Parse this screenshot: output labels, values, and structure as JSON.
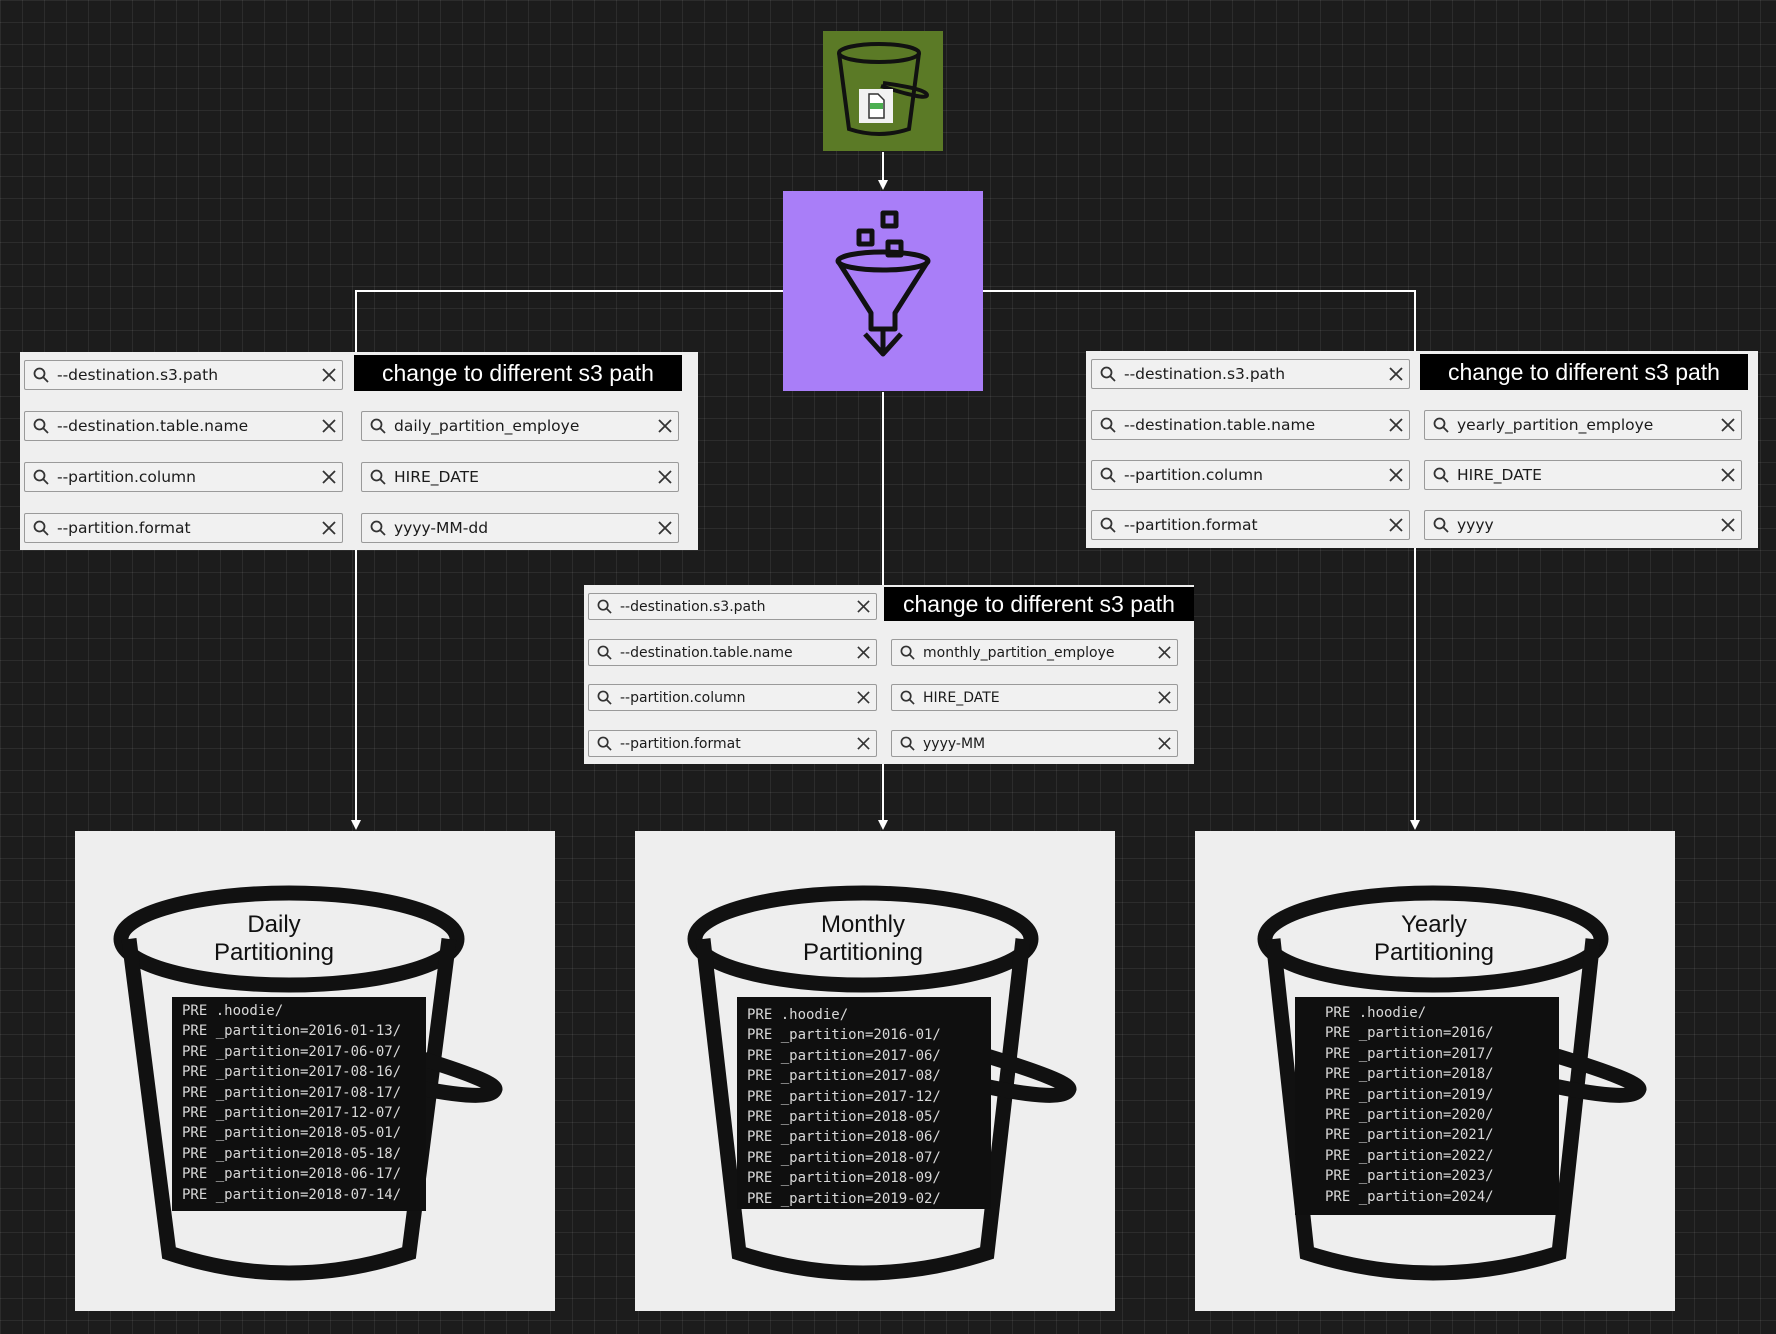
{
  "panels": {
    "daily": {
      "note": "change to different s3 path",
      "param_keys": [
        "--destination.s3.path",
        "--destination.table.name",
        "--partition.column",
        "--partition.format"
      ],
      "param_values": [
        "daily_partition_employe",
        "HIRE_DATE",
        "yyyy-MM-dd"
      ]
    },
    "monthly": {
      "note": "change to different s3 path",
      "param_keys": [
        "--destination.s3.path",
        "--destination.table.name",
        "--partition.column",
        "--partition.format"
      ],
      "param_values": [
        "monthly_partition_employe",
        "HIRE_DATE",
        "yyyy-MM"
      ]
    },
    "yearly": {
      "note": "change to different s3 path",
      "param_keys": [
        "--destination.s3.path",
        "--destination.table.name",
        "--partition.column",
        "--partition.format"
      ],
      "param_values": [
        "yearly_partition_employe",
        "HIRE_DATE",
        "yyyy"
      ]
    }
  },
  "buckets": {
    "daily": {
      "title_line1": "Daily",
      "title_line2": "Partitioning",
      "listing": [
        "PRE .hoodie/",
        "PRE _partition=2016-01-13/",
        "PRE _partition=2017-06-07/",
        "PRE _partition=2017-08-16/",
        "PRE _partition=2017-08-17/",
        "PRE _partition=2017-12-07/",
        "PRE _partition=2018-05-01/",
        "PRE _partition=2018-05-18/",
        "PRE _partition=2018-06-17/",
        "PRE _partition=2018-07-14/"
      ]
    },
    "monthly": {
      "title_line1": "Monthly",
      "title_line2": "Partitioning",
      "listing": [
        "PRE .hoodie/",
        "PRE _partition=2016-01/",
        "PRE _partition=2017-06/",
        "PRE _partition=2017-08/",
        "PRE _partition=2017-12/",
        "PRE _partition=2018-05/",
        "PRE _partition=2018-06/",
        "PRE _partition=2018-07/",
        "PRE _partition=2018-09/",
        "PRE _partition=2019-02/"
      ]
    },
    "yearly": {
      "title_line1": "Yearly",
      "title_line2": "Partitioning",
      "listing": [
        "PRE .hoodie/",
        "PRE _partition=2016/",
        "PRE _partition=2017/",
        "PRE _partition=2018/",
        "PRE _partition=2019/",
        "PRE _partition=2020/",
        "PRE _partition=2021/",
        "PRE _partition=2022/",
        "PRE _partition=2023/",
        "PRE _partition=2024/"
      ]
    }
  },
  "icons": {
    "source": "s3-bucket-csv-icon",
    "transform": "glue-funnel-icon",
    "source_bg": "#5b7a26",
    "transform_bg": "#a97ef8"
  }
}
